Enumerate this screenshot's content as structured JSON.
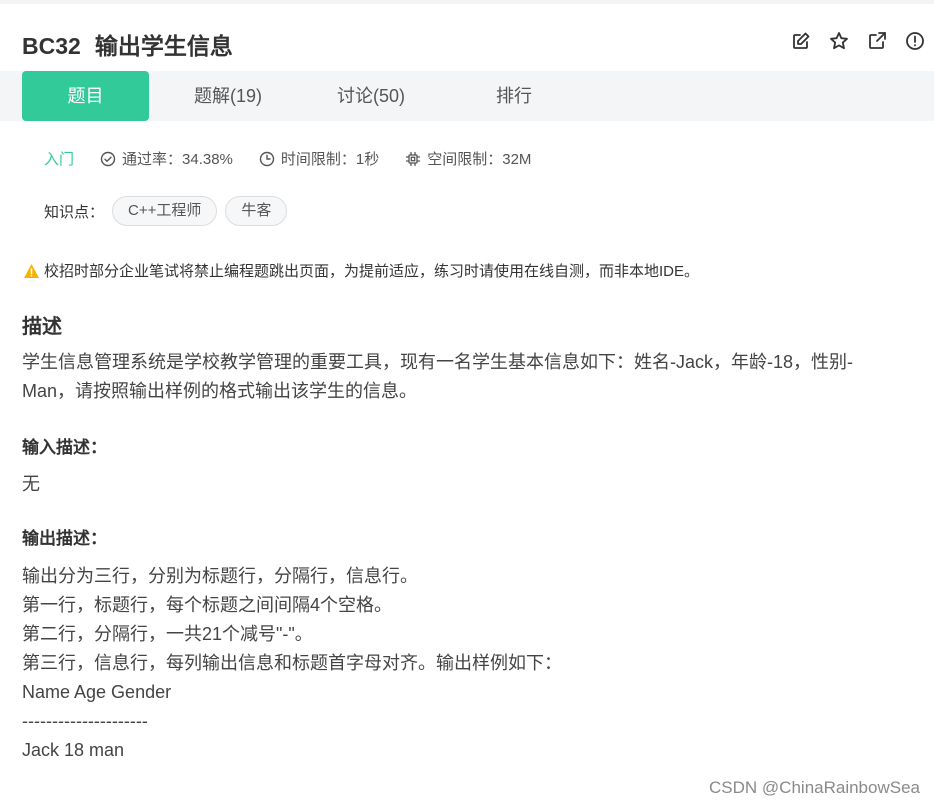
{
  "header": {
    "problem_id": "BC32",
    "problem_title": "输出学生信息",
    "actions": [
      {
        "name": "edit-icon"
      },
      {
        "name": "star-icon"
      },
      {
        "name": "share-icon"
      },
      {
        "name": "report-icon"
      }
    ]
  },
  "tabs": [
    {
      "label": "题目",
      "active": true
    },
    {
      "label": "题解(19)",
      "active": false
    },
    {
      "label": "讨论(50)",
      "active": false
    },
    {
      "label": "排行",
      "active": false
    }
  ],
  "meta": {
    "difficulty": "入门",
    "pass_rate": "通过率：34.38%",
    "time_limit": "时间限制：1秒",
    "memory_limit": "空间限制：32M"
  },
  "knowledge": {
    "label": "知识点：",
    "tags": [
      "C++工程师",
      "牛客"
    ]
  },
  "warning": "校招时部分企业笔试将禁止编程题跳出页面，为提前适应，练习时请使用在线自测，而非本地IDE。",
  "description": {
    "heading": "描述",
    "text": "学生信息管理系统是学校教学管理的重要工具，现有一名学生基本信息如下：姓名-Jack，年龄-18，性别-Man，请按照输出样例的格式输出该学生的信息。"
  },
  "input": {
    "heading": "输入描述：",
    "text": "无"
  },
  "output": {
    "heading": "输出描述：",
    "lines": [
      "输出分为三行，分别为标题行，分隔行，信息行。",
      "第一行，标题行，每个标题之间间隔4个空格。",
      "第二行，分隔行，一共21个减号\"-\"。",
      "第三行，信息行，每列输出信息和标题首字母对齐。输出样例如下：",
      "Name Age Gender",
      "---------------------",
      "Jack 18 man"
    ]
  },
  "watermark": "CSDN @ChinaRainbowSea",
  "colors": {
    "accent": "#32ca99",
    "warning": "#f5b400"
  }
}
